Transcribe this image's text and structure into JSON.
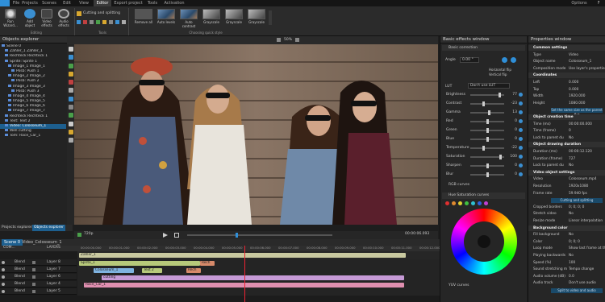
{
  "menu": {
    "tabs": [
      "File",
      "Projects",
      "Scenes",
      "Edit",
      "View",
      "Editor",
      "Export project",
      "Tools",
      "Activation"
    ],
    "right": "Options"
  },
  "ribbon": {
    "run_wizard": "Run\nWizard...",
    "add_object": "Add\nobject",
    "video_effects": "Video\neffects",
    "audio_effects": "Audio\neffects",
    "editing_label": "Editing",
    "cutting": "Cutting and splitting",
    "tools_label": "Tools",
    "quick": [
      "Remove all",
      "Auto levels",
      "Auto contrast",
      "Grayscale",
      "Grayscale",
      "Grayscale"
    ],
    "quick_label": "Choosing quick style"
  },
  "objects": {
    "title": "Objects explorer",
    "items": [
      "Scene 0",
      "Zähler_1 Zähler_1",
      "Rechteck Rechteck 1",
      "Sprite: Sprite 1",
      "Image_1 Image_1",
      "Posb: Push 1",
      "Image_2 Image_2",
      "Posb: Push 2",
      "Image_3 Image_3",
      "Posb: Push 3",
      "Image_4 Image_4",
      "Image_5 Image_5",
      "Image_6 Image_6",
      "Image_7 Image_7",
      "Rechteck Rechteck 1",
      "Text: Text 2",
      "Video: Colosseum_1",
      "Well cutting",
      "Tom: Race_Car_1"
    ],
    "tabs": [
      "Projects explorer",
      "Objects explorer"
    ]
  },
  "player": {
    "zoom": "720p",
    "pos": "50%",
    "time": "00:00:06.093",
    "scene": "Scene 0",
    "clip": "Video_Colosseum_1"
  },
  "basic": {
    "title": "Basic effects window",
    "section": "Basic correction",
    "angle_label": "Angle",
    "angle_value": "0.00 °",
    "lut_label": "LUT",
    "lut_value": "Don't use LUT",
    "sliders": [
      {
        "label": "Brightness",
        "value": "77"
      },
      {
        "label": "Contrast",
        "value": "-23"
      },
      {
        "label": "Gamma",
        "value": "13"
      },
      {
        "label": "Red",
        "value": "0"
      },
      {
        "label": "Green",
        "value": "0"
      },
      {
        "label": "Blue",
        "value": "0"
      },
      {
        "label": "Temperature",
        "value": "-22"
      },
      {
        "label": "Saturation",
        "value": "100"
      },
      {
        "label": "Sharpen",
        "value": "0"
      },
      {
        "label": "Blur",
        "value": "0"
      }
    ],
    "rgb_curves": "RGB curves",
    "hue_sat": "Hue Saturation curves",
    "yuv": "YUV curves",
    "flip_h": "Horizontal flip",
    "flip_v": "Vertical flip"
  },
  "props": {
    "title": "Properties window",
    "rows": [
      {
        "k": "Common settings",
        "v": "",
        "sec": true
      },
      {
        "k": "Type",
        "v": "Video"
      },
      {
        "k": "Object name",
        "v": "Colosseum_1"
      },
      {
        "k": "Composition mode",
        "v": "Use layer's properties"
      },
      {
        "k": "Coordinates",
        "v": "",
        "sec": true
      },
      {
        "k": "Left",
        "v": "0.000"
      },
      {
        "k": "Top",
        "v": "0.000"
      },
      {
        "k": "Width",
        "v": "1920.000"
      },
      {
        "k": "Height",
        "v": "1080.000"
      },
      {
        "k": "",
        "v": "Set the same size as the parent flat",
        "btn": true
      },
      {
        "k": "Object creation time",
        "v": "",
        "sec": true
      },
      {
        "k": "Time (ms)",
        "v": "00:00:00.000"
      },
      {
        "k": "Time (frame)",
        "v": "0"
      },
      {
        "k": "Lock to parent du",
        "v": "No"
      },
      {
        "k": "Object drawing duration",
        "v": "",
        "sec": true
      },
      {
        "k": "Duration (ms)",
        "v": "00:00:12.120"
      },
      {
        "k": "Duration (frame)",
        "v": "727"
      },
      {
        "k": "Lock to parent du",
        "v": "No"
      },
      {
        "k": "Video object settings",
        "v": "",
        "sec": true
      },
      {
        "k": "Video",
        "v": "Colosseum.mp4"
      },
      {
        "k": "Resolution",
        "v": "1920x1080"
      },
      {
        "k": "Frame rate",
        "v": "59.940 fps"
      },
      {
        "k": "",
        "v": "Cutting and splitting",
        "btn": true
      },
      {
        "k": "Cropped borders",
        "v": "0; 0; 0; 0"
      },
      {
        "k": "Stretch video",
        "v": "No"
      },
      {
        "k": "Resize mode",
        "v": "Linear interpolation"
      },
      {
        "k": "Background color",
        "v": "",
        "sec": true
      },
      {
        "k": "Fill background",
        "v": "No"
      },
      {
        "k": "Color",
        "v": "0; 0; 0"
      },
      {
        "k": "Loop mode",
        "v": "Show last frame at the"
      },
      {
        "k": "Playing backwards",
        "v": "No"
      },
      {
        "k": "Speed (%)",
        "v": "100"
      },
      {
        "k": "Sound stretching m",
        "v": "Tempo change"
      },
      {
        "k": "Audio volume (dB)",
        "v": "0.0"
      },
      {
        "k": "Audio track",
        "v": "Don't use audio"
      },
      {
        "k": "",
        "v": "Split to video and audio",
        "btn": true
      }
    ]
  },
  "timeline": {
    "tabs": [
      "Scene 0",
      "Video_Colosseum_1"
    ],
    "header": "LAYERS",
    "com": "COM...",
    "ticks": [
      "00:00:00.000",
      "00:00:01.000",
      "00:00:02.000",
      "00:00:03.000",
      "00:00:04.000",
      "00:00:05.000",
      "00:00:06.000",
      "00:00:07.000",
      "00:00:08.000",
      "00:00:09.000",
      "00:00:10.000",
      "00:00:11.000",
      "00:00:12.000"
    ],
    "layers": [
      {
        "blend": "Blend",
        "name": "Layer 8"
      },
      {
        "blend": "Blend",
        "name": "Layer 7"
      },
      {
        "blend": "Blend",
        "name": "Layer 6"
      },
      {
        "blend": "Blend",
        "name": "Layer 4"
      },
      {
        "blend": "Blend",
        "name": "Layer 5"
      }
    ],
    "clips": [
      "Zähler_1",
      "Sprite_1",
      "Rech",
      "Colosseum_1",
      "Text 2",
      "Rech",
      "cutting",
      "Race_Car_1"
    ]
  },
  "colors": {
    "accent": "#2f8fd8",
    "selection": "#1d5f8f"
  }
}
